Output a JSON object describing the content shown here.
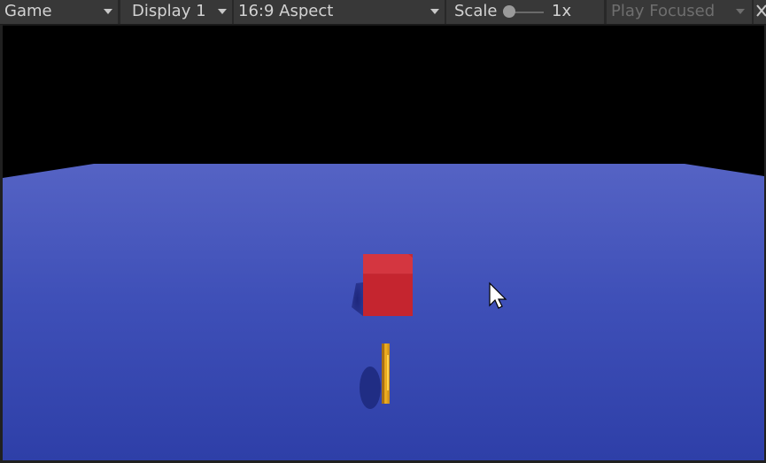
{
  "toolbar": {
    "view_selector": {
      "label": "Game",
      "icon": "dropdown-caret"
    },
    "display_selector": {
      "label": "Display 1",
      "icon": "dropdown-caret"
    },
    "aspect_selector": {
      "label": "16:9 Aspect",
      "icon": "dropdown-caret"
    },
    "scale": {
      "label": "Scale",
      "value_label": "1x",
      "value": 1
    },
    "play_mode_selector": {
      "label": "Play Focused",
      "icon": "dropdown-caret"
    },
    "overflow_icon": "close-icon"
  },
  "scene": {
    "sky_color": "#000000",
    "ground_color_far": "#5563c4",
    "ground_color_near": "#2e3fa8",
    "cube_color": "#cc2b35",
    "coin_color": "#e8a317",
    "objects": [
      "ground-plane",
      "red-cube",
      "gold-coin"
    ],
    "cursor": "mouse-pointer-icon"
  },
  "colors": {
    "toolbar_bg": "#282828",
    "control_bg": "#383838",
    "text": "#d2d2d2",
    "text_disabled": "#6e6e6e"
  }
}
